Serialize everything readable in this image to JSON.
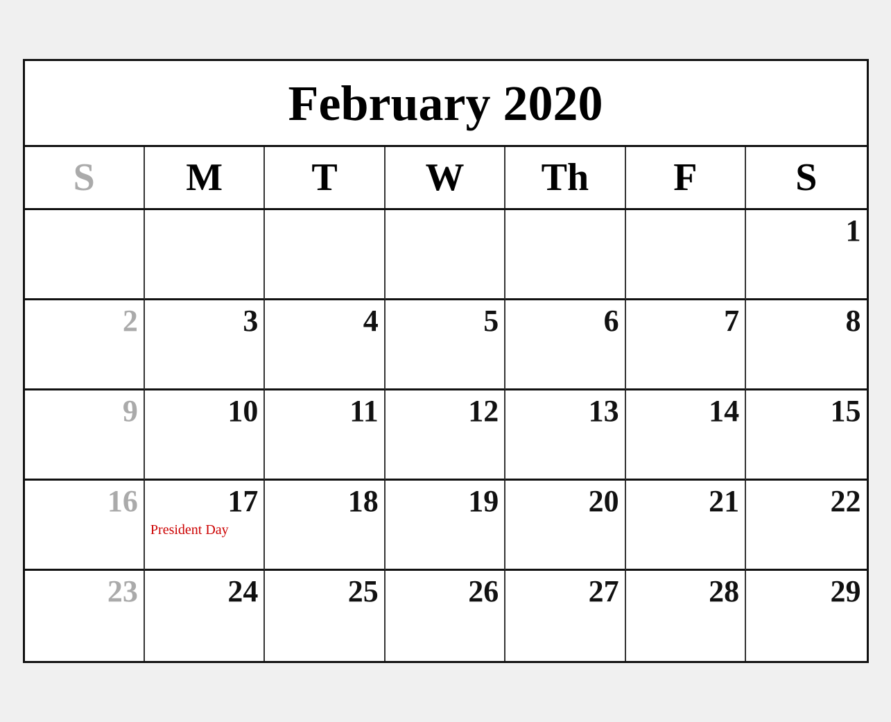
{
  "calendar": {
    "title": "February 2020",
    "day_headers": [
      {
        "label": "S",
        "key": "sun",
        "dimmed": true
      },
      {
        "label": "M",
        "key": "mon",
        "dimmed": false
      },
      {
        "label": "T",
        "key": "tue",
        "dimmed": false
      },
      {
        "label": "W",
        "key": "wed",
        "dimmed": false
      },
      {
        "label": "Th",
        "key": "thu",
        "dimmed": false
      },
      {
        "label": "F",
        "key": "fri",
        "dimmed": false
      },
      {
        "label": "S",
        "key": "sat",
        "dimmed": false
      }
    ],
    "weeks": [
      [
        {
          "day": "",
          "dimmed": false,
          "event": ""
        },
        {
          "day": "",
          "dimmed": false,
          "event": ""
        },
        {
          "day": "",
          "dimmed": false,
          "event": ""
        },
        {
          "day": "",
          "dimmed": false,
          "event": ""
        },
        {
          "day": "",
          "dimmed": false,
          "event": ""
        },
        {
          "day": "",
          "dimmed": false,
          "event": ""
        },
        {
          "day": "1",
          "dimmed": false,
          "event": ""
        }
      ],
      [
        {
          "day": "2",
          "dimmed": true,
          "event": ""
        },
        {
          "day": "3",
          "dimmed": false,
          "event": ""
        },
        {
          "day": "4",
          "dimmed": false,
          "event": ""
        },
        {
          "day": "5",
          "dimmed": false,
          "event": ""
        },
        {
          "day": "6",
          "dimmed": false,
          "event": ""
        },
        {
          "day": "7",
          "dimmed": false,
          "event": ""
        },
        {
          "day": "8",
          "dimmed": false,
          "event": ""
        }
      ],
      [
        {
          "day": "9",
          "dimmed": true,
          "event": ""
        },
        {
          "day": "10",
          "dimmed": false,
          "event": ""
        },
        {
          "day": "11",
          "dimmed": false,
          "event": ""
        },
        {
          "day": "12",
          "dimmed": false,
          "event": ""
        },
        {
          "day": "13",
          "dimmed": false,
          "event": ""
        },
        {
          "day": "14",
          "dimmed": false,
          "event": ""
        },
        {
          "day": "15",
          "dimmed": false,
          "event": ""
        }
      ],
      [
        {
          "day": "16",
          "dimmed": true,
          "event": ""
        },
        {
          "day": "17",
          "dimmed": false,
          "event": "President Day"
        },
        {
          "day": "18",
          "dimmed": false,
          "event": ""
        },
        {
          "day": "19",
          "dimmed": false,
          "event": ""
        },
        {
          "day": "20",
          "dimmed": false,
          "event": ""
        },
        {
          "day": "21",
          "dimmed": false,
          "event": ""
        },
        {
          "day": "22",
          "dimmed": false,
          "event": ""
        }
      ],
      [
        {
          "day": "23",
          "dimmed": true,
          "event": ""
        },
        {
          "day": "24",
          "dimmed": false,
          "event": ""
        },
        {
          "day": "25",
          "dimmed": false,
          "event": ""
        },
        {
          "day": "26",
          "dimmed": false,
          "event": ""
        },
        {
          "day": "27",
          "dimmed": false,
          "event": ""
        },
        {
          "day": "28",
          "dimmed": false,
          "event": ""
        },
        {
          "day": "29",
          "dimmed": false,
          "event": ""
        }
      ]
    ]
  }
}
